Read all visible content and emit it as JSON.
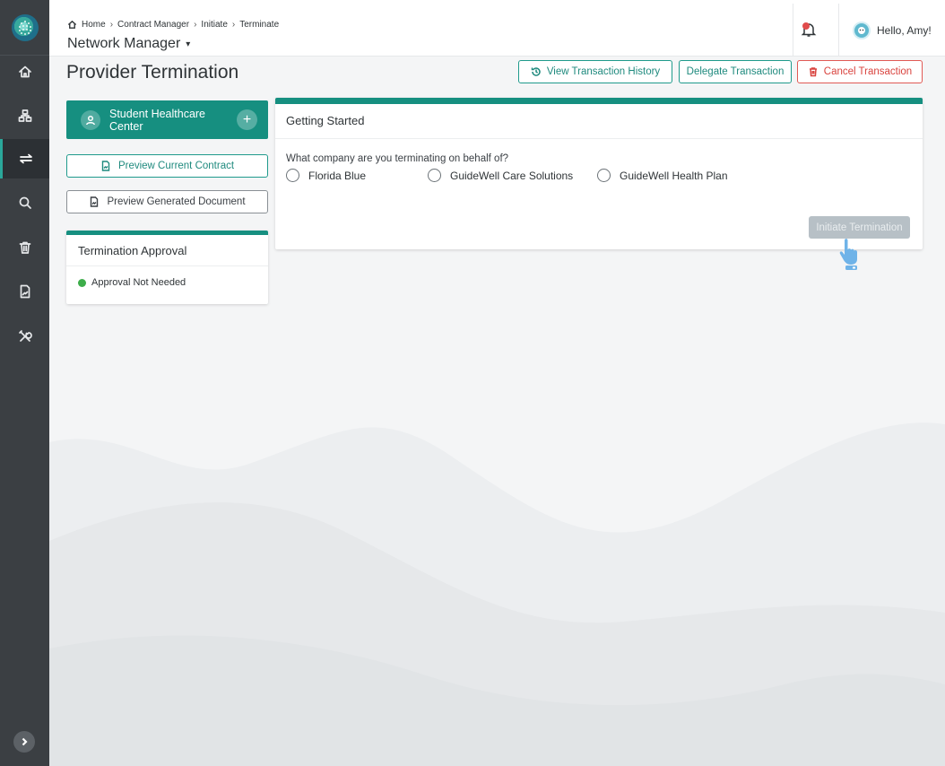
{
  "sidebar": {
    "logo_icon": "globe-logo-icon",
    "items": [
      {
        "name": "home",
        "icon": "home-icon"
      },
      {
        "name": "network",
        "icon": "network-icon"
      },
      {
        "name": "transactions",
        "icon": "transactions-icon",
        "active": true
      },
      {
        "name": "search",
        "icon": "search-icon"
      },
      {
        "name": "delete",
        "icon": "trash-icon"
      },
      {
        "name": "documents",
        "icon": "document-icon"
      },
      {
        "name": "tools",
        "icon": "tools-icon"
      }
    ],
    "expand_icon": "chevron-right-icon"
  },
  "header": {
    "breadcrumb": [
      "Home",
      "Contract Manager",
      "Initiate",
      "Terminate"
    ],
    "app_title": "Network Manager",
    "greeting": "Hello, Amy!"
  },
  "page": {
    "title": "Provider Termination",
    "actions": {
      "history": "View Transaction History",
      "delegate": "Delegate Transaction",
      "cancel": "Cancel Transaction"
    }
  },
  "provider": {
    "name": "Student Healthcare Center"
  },
  "previews": {
    "current": "Preview Current Contract",
    "generated": "Preview Generated Document"
  },
  "approval": {
    "title": "Termination Approval",
    "status": "Approval Not Needed"
  },
  "getting_started": {
    "title": "Getting Started",
    "question": "What company are you terminating on behalf of?",
    "options": [
      "Florida Blue",
      "GuideWell Care Solutions",
      "GuideWell Health Plan"
    ],
    "submit": "Initiate Termination"
  },
  "colors": {
    "accent": "#168f80",
    "danger": "#d9433e",
    "sidebar": "#3b3f43",
    "status_ok": "#3dad4a"
  }
}
